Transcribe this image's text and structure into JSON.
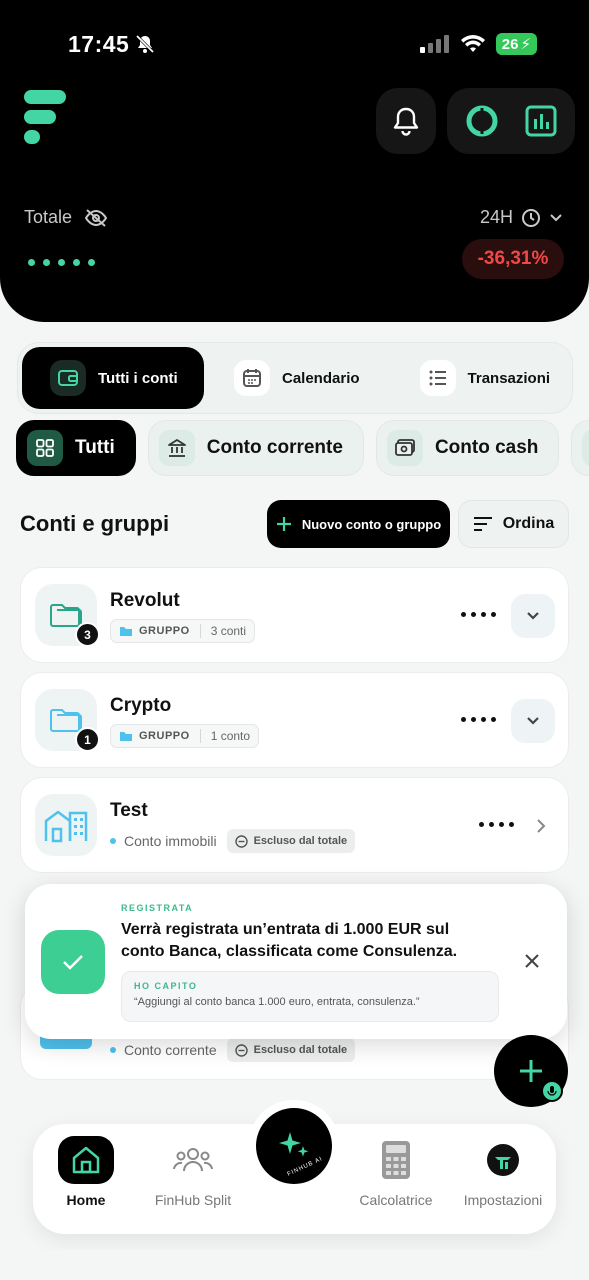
{
  "status_bar": {
    "time": "17:45",
    "battery": "26"
  },
  "header": {
    "total_label": "Totale",
    "period": "24H",
    "change": "-36,31%",
    "colors": {
      "accent": "#43d6a4",
      "negative": "#f04848"
    }
  },
  "top_tabs": [
    {
      "label": "Tutti i conti",
      "active": true
    },
    {
      "label": "Calendario"
    },
    {
      "label": "Transazioni"
    }
  ],
  "filters": [
    {
      "label": "Tutti",
      "active": true
    },
    {
      "label": "Conto corrente"
    },
    {
      "label": "Conto cash"
    }
  ],
  "section": {
    "title": "Conti e gruppi",
    "new_button": "Nuovo conto o gruppo",
    "sort_button": "Ordina"
  },
  "accounts": [
    {
      "name": "Revolut",
      "type": "GRUPPO",
      "count_text": "3 conti",
      "count": "3"
    },
    {
      "name": "Crypto",
      "type": "GRUPPO",
      "count_text": "1 conto",
      "count": "1"
    },
    {
      "name": "Test",
      "type": "Conto immobili",
      "excluded": "Escluso dal totale"
    },
    {
      "type": "Conto corrente",
      "excluded": "Escluso dal totale"
    }
  ],
  "toast": {
    "label": "REGISTRATA",
    "message": "Verrà registrata un’entrata di 1.000 EUR sul conto Banca, classificata come Consulenza.",
    "note_label": "HO CAPITO",
    "note_text": "“Aggiungi al conto banca 1.000 euro, entrata, consulenza.”"
  },
  "bottom_nav": [
    {
      "label": "Home",
      "active": true
    },
    {
      "label": "FinHub Split"
    },
    {
      "label": "Calcolatrice"
    },
    {
      "label": "Impostazioni"
    }
  ],
  "ai_button_text": "FINHUB AI"
}
